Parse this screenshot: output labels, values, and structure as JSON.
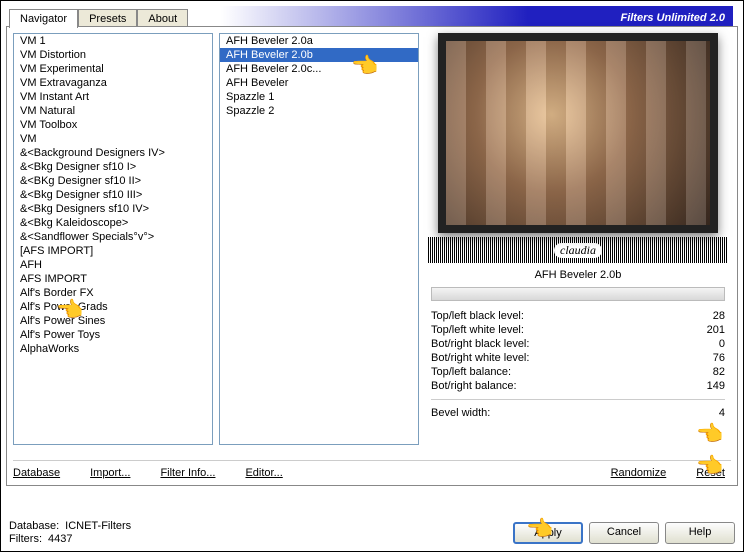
{
  "title": "Filters Unlimited 2.0",
  "tabs": [
    "Navigator",
    "Presets",
    "About"
  ],
  "activeTab": 0,
  "categories": [
    "VM 1",
    "VM Distortion",
    "VM Experimental",
    "VM Extravaganza",
    "VM Instant Art",
    "VM Natural",
    "VM Toolbox",
    "VM",
    "&<Background Designers IV>",
    "&<Bkg Designer sf10 I>",
    "&<BKg Designer sf10 II>",
    "&<Bkg Designer sf10 III>",
    "&<Bkg Designers sf10 IV>",
    "&<Bkg Kaleidoscope>",
    "&<Sandflower Specials°v°>",
    "[AFS IMPORT]",
    "AFH",
    "AFS IMPORT",
    "Alf's Border FX",
    "Alf's Power Grads",
    "Alf's Power Sines",
    "Alf's Power Toys",
    "AlphaWorks"
  ],
  "selectedCategoryIndex": 16,
  "filters": [
    "AFH Beveler 2.0a",
    "AFH Beveler 2.0b",
    "AFH Beveler 2.0c...",
    "AFH Beveler",
    "Spazzle 1",
    "Spazzle 2"
  ],
  "selectedFilterIndex": 1,
  "filterDisplayName": "AFH Beveler 2.0b",
  "params": [
    {
      "label": "Top/left black level:",
      "value": "28"
    },
    {
      "label": "Top/left white level:",
      "value": "201"
    },
    {
      "label": "Bot/right black level:",
      "value": "0"
    },
    {
      "label": "Bot/right white level:",
      "value": "76"
    },
    {
      "label": "Top/left balance:",
      "value": "82"
    },
    {
      "label": "Bot/right balance:",
      "value": "149"
    }
  ],
  "bevel": {
    "label": "Bevel width:",
    "value": "4"
  },
  "links": {
    "database": "Database",
    "import": "Import...",
    "filterInfo": "Filter Info...",
    "editor": "Editor...",
    "randomize": "Randomize",
    "reset": "Reset"
  },
  "status": {
    "dbLabel": "Database:",
    "dbValue": "ICNET-Filters",
    "filtersLabel": "Filters:",
    "filtersValue": "4437"
  },
  "buttons": {
    "apply": "Apply",
    "cancel": "Cancel",
    "help": "Help"
  },
  "watermark": "claudia"
}
